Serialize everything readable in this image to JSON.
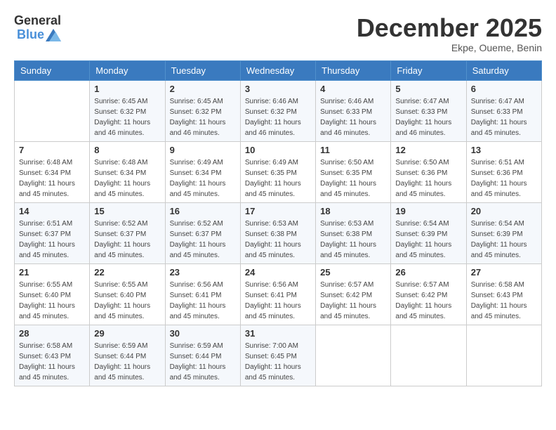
{
  "header": {
    "logo_general": "General",
    "logo_blue": "Blue",
    "month_title": "December 2025",
    "location": "Ekpe, Oueme, Benin"
  },
  "weekdays": [
    "Sunday",
    "Monday",
    "Tuesday",
    "Wednesday",
    "Thursday",
    "Friday",
    "Saturday"
  ],
  "weeks": [
    [
      {
        "day": "",
        "sunrise": "",
        "sunset": "",
        "daylight": ""
      },
      {
        "day": "1",
        "sunrise": "Sunrise: 6:45 AM",
        "sunset": "Sunset: 6:32 PM",
        "daylight": "Daylight: 11 hours and 46 minutes."
      },
      {
        "day": "2",
        "sunrise": "Sunrise: 6:45 AM",
        "sunset": "Sunset: 6:32 PM",
        "daylight": "Daylight: 11 hours and 46 minutes."
      },
      {
        "day": "3",
        "sunrise": "Sunrise: 6:46 AM",
        "sunset": "Sunset: 6:32 PM",
        "daylight": "Daylight: 11 hours and 46 minutes."
      },
      {
        "day": "4",
        "sunrise": "Sunrise: 6:46 AM",
        "sunset": "Sunset: 6:33 PM",
        "daylight": "Daylight: 11 hours and 46 minutes."
      },
      {
        "day": "5",
        "sunrise": "Sunrise: 6:47 AM",
        "sunset": "Sunset: 6:33 PM",
        "daylight": "Daylight: 11 hours and 46 minutes."
      },
      {
        "day": "6",
        "sunrise": "Sunrise: 6:47 AM",
        "sunset": "Sunset: 6:33 PM",
        "daylight": "Daylight: 11 hours and 45 minutes."
      }
    ],
    [
      {
        "day": "7",
        "sunrise": "Sunrise: 6:48 AM",
        "sunset": "Sunset: 6:34 PM",
        "daylight": "Daylight: 11 hours and 45 minutes."
      },
      {
        "day": "8",
        "sunrise": "Sunrise: 6:48 AM",
        "sunset": "Sunset: 6:34 PM",
        "daylight": "Daylight: 11 hours and 45 minutes."
      },
      {
        "day": "9",
        "sunrise": "Sunrise: 6:49 AM",
        "sunset": "Sunset: 6:34 PM",
        "daylight": "Daylight: 11 hours and 45 minutes."
      },
      {
        "day": "10",
        "sunrise": "Sunrise: 6:49 AM",
        "sunset": "Sunset: 6:35 PM",
        "daylight": "Daylight: 11 hours and 45 minutes."
      },
      {
        "day": "11",
        "sunrise": "Sunrise: 6:50 AM",
        "sunset": "Sunset: 6:35 PM",
        "daylight": "Daylight: 11 hours and 45 minutes."
      },
      {
        "day": "12",
        "sunrise": "Sunrise: 6:50 AM",
        "sunset": "Sunset: 6:36 PM",
        "daylight": "Daylight: 11 hours and 45 minutes."
      },
      {
        "day": "13",
        "sunrise": "Sunrise: 6:51 AM",
        "sunset": "Sunset: 6:36 PM",
        "daylight": "Daylight: 11 hours and 45 minutes."
      }
    ],
    [
      {
        "day": "14",
        "sunrise": "Sunrise: 6:51 AM",
        "sunset": "Sunset: 6:37 PM",
        "daylight": "Daylight: 11 hours and 45 minutes."
      },
      {
        "day": "15",
        "sunrise": "Sunrise: 6:52 AM",
        "sunset": "Sunset: 6:37 PM",
        "daylight": "Daylight: 11 hours and 45 minutes."
      },
      {
        "day": "16",
        "sunrise": "Sunrise: 6:52 AM",
        "sunset": "Sunset: 6:37 PM",
        "daylight": "Daylight: 11 hours and 45 minutes."
      },
      {
        "day": "17",
        "sunrise": "Sunrise: 6:53 AM",
        "sunset": "Sunset: 6:38 PM",
        "daylight": "Daylight: 11 hours and 45 minutes."
      },
      {
        "day": "18",
        "sunrise": "Sunrise: 6:53 AM",
        "sunset": "Sunset: 6:38 PM",
        "daylight": "Daylight: 11 hours and 45 minutes."
      },
      {
        "day": "19",
        "sunrise": "Sunrise: 6:54 AM",
        "sunset": "Sunset: 6:39 PM",
        "daylight": "Daylight: 11 hours and 45 minutes."
      },
      {
        "day": "20",
        "sunrise": "Sunrise: 6:54 AM",
        "sunset": "Sunset: 6:39 PM",
        "daylight": "Daylight: 11 hours and 45 minutes."
      }
    ],
    [
      {
        "day": "21",
        "sunrise": "Sunrise: 6:55 AM",
        "sunset": "Sunset: 6:40 PM",
        "daylight": "Daylight: 11 hours and 45 minutes."
      },
      {
        "day": "22",
        "sunrise": "Sunrise: 6:55 AM",
        "sunset": "Sunset: 6:40 PM",
        "daylight": "Daylight: 11 hours and 45 minutes."
      },
      {
        "day": "23",
        "sunrise": "Sunrise: 6:56 AM",
        "sunset": "Sunset: 6:41 PM",
        "daylight": "Daylight: 11 hours and 45 minutes."
      },
      {
        "day": "24",
        "sunrise": "Sunrise: 6:56 AM",
        "sunset": "Sunset: 6:41 PM",
        "daylight": "Daylight: 11 hours and 45 minutes."
      },
      {
        "day": "25",
        "sunrise": "Sunrise: 6:57 AM",
        "sunset": "Sunset: 6:42 PM",
        "daylight": "Daylight: 11 hours and 45 minutes."
      },
      {
        "day": "26",
        "sunrise": "Sunrise: 6:57 AM",
        "sunset": "Sunset: 6:42 PM",
        "daylight": "Daylight: 11 hours and 45 minutes."
      },
      {
        "day": "27",
        "sunrise": "Sunrise: 6:58 AM",
        "sunset": "Sunset: 6:43 PM",
        "daylight": "Daylight: 11 hours and 45 minutes."
      }
    ],
    [
      {
        "day": "28",
        "sunrise": "Sunrise: 6:58 AM",
        "sunset": "Sunset: 6:43 PM",
        "daylight": "Daylight: 11 hours and 45 minutes."
      },
      {
        "day": "29",
        "sunrise": "Sunrise: 6:59 AM",
        "sunset": "Sunset: 6:44 PM",
        "daylight": "Daylight: 11 hours and 45 minutes."
      },
      {
        "day": "30",
        "sunrise": "Sunrise: 6:59 AM",
        "sunset": "Sunset: 6:44 PM",
        "daylight": "Daylight: 11 hours and 45 minutes."
      },
      {
        "day": "31",
        "sunrise": "Sunrise: 7:00 AM",
        "sunset": "Sunset: 6:45 PM",
        "daylight": "Daylight: 11 hours and 45 minutes."
      },
      {
        "day": "",
        "sunrise": "",
        "sunset": "",
        "daylight": ""
      },
      {
        "day": "",
        "sunrise": "",
        "sunset": "",
        "daylight": ""
      },
      {
        "day": "",
        "sunrise": "",
        "sunset": "",
        "daylight": ""
      }
    ]
  ]
}
